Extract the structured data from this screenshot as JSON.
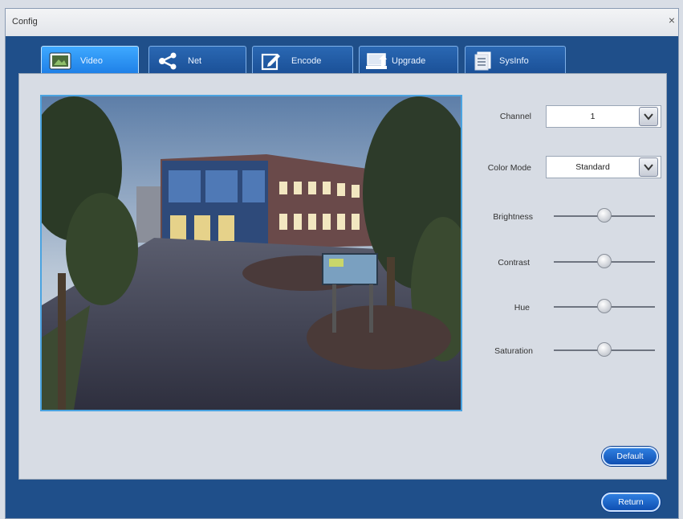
{
  "window": {
    "title": "Config",
    "close_glyph": "×"
  },
  "tabs": [
    {
      "label": "Video",
      "icon": "video-icon",
      "active": true
    },
    {
      "label": "Net",
      "icon": "share-icon",
      "active": false
    },
    {
      "label": "Encode",
      "icon": "edit-icon",
      "active": false
    },
    {
      "label": "Upgrade",
      "icon": "upload-icon",
      "active": false
    },
    {
      "label": "SysInfo",
      "icon": "document-icon",
      "active": false
    }
  ],
  "controls": {
    "channel": {
      "label": "Channel",
      "value": "1"
    },
    "color_mode": {
      "label": "Color Mode",
      "value": "Standard"
    },
    "brightness": {
      "label": "Brightness",
      "level": 0.5
    },
    "contrast": {
      "label": "Contrast",
      "level": 0.5
    },
    "hue": {
      "label": "Hue",
      "level": 0.5
    },
    "saturation": {
      "label": "Saturation",
      "level": 0.5
    }
  },
  "buttons": {
    "default": "Default",
    "return": "Return"
  },
  "colors": {
    "accent": "#1f4f8a",
    "active_tab": "#3ea9ff"
  }
}
